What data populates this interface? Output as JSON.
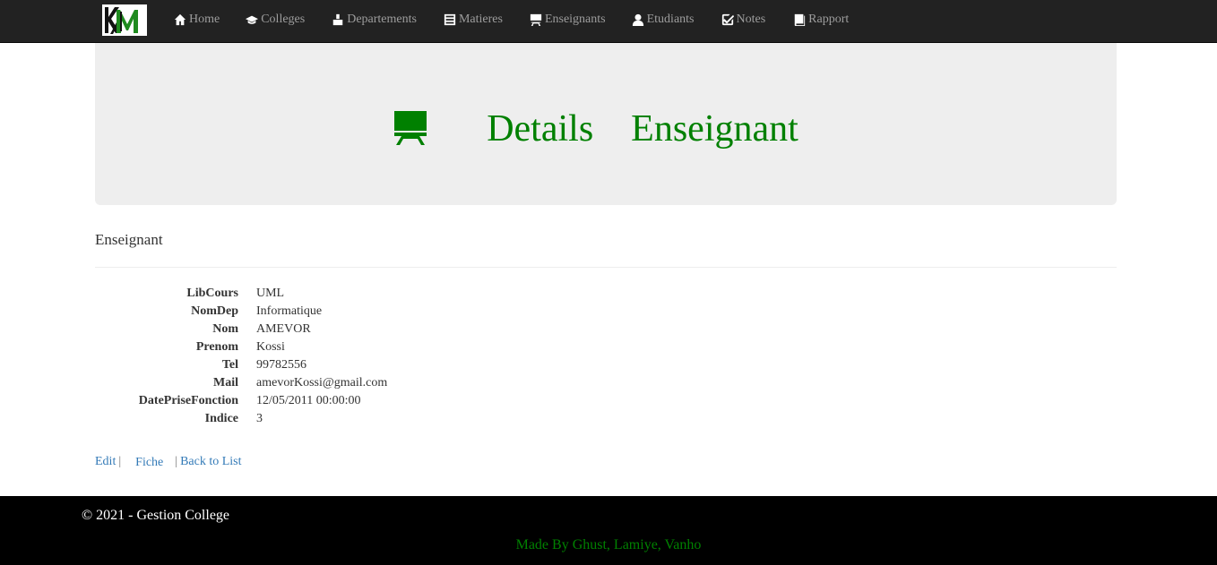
{
  "nav": {
    "items": [
      {
        "label": "Home",
        "icon": "home-icon"
      },
      {
        "label": "Colleges",
        "icon": "graduation-cap-icon"
      },
      {
        "label": "Departements",
        "icon": "building-icon"
      },
      {
        "label": "Matieres",
        "icon": "list-icon"
      },
      {
        "label": "Enseignants",
        "icon": "blackboard-icon"
      },
      {
        "label": "Etudiants",
        "icon": "user-icon"
      },
      {
        "label": "Notes",
        "icon": "check-icon"
      },
      {
        "label": "Rapport",
        "icon": "book-icon"
      }
    ]
  },
  "jumbotron": {
    "word1": "Details",
    "word2": "Enseignant",
    "icon": "blackboard-icon",
    "color": "#008000"
  },
  "section_title": "Enseignant",
  "details": [
    {
      "label": "LibCours",
      "value": "UML"
    },
    {
      "label": "NomDep",
      "value": "Informatique"
    },
    {
      "label": "Nom",
      "value": "AMEVOR"
    },
    {
      "label": "Prenom",
      "value": "Kossi"
    },
    {
      "label": "Tel",
      "value": "99782556"
    },
    {
      "label": "Mail",
      "value": "amevorKossi@gmail.com"
    },
    {
      "label": "DatePriseFonction",
      "value": "12/05/2011 00:00:00"
    },
    {
      "label": "Indice",
      "value": "3"
    }
  ],
  "actions": {
    "edit": "Edit",
    "sep1": "|",
    "fiche": "Fiche",
    "sep2": "|",
    "back": "Back to List"
  },
  "footer": {
    "copyright": "© 2021 - Gestion College",
    "credit": "Made By Ghust, Lamiye, Vanho"
  }
}
